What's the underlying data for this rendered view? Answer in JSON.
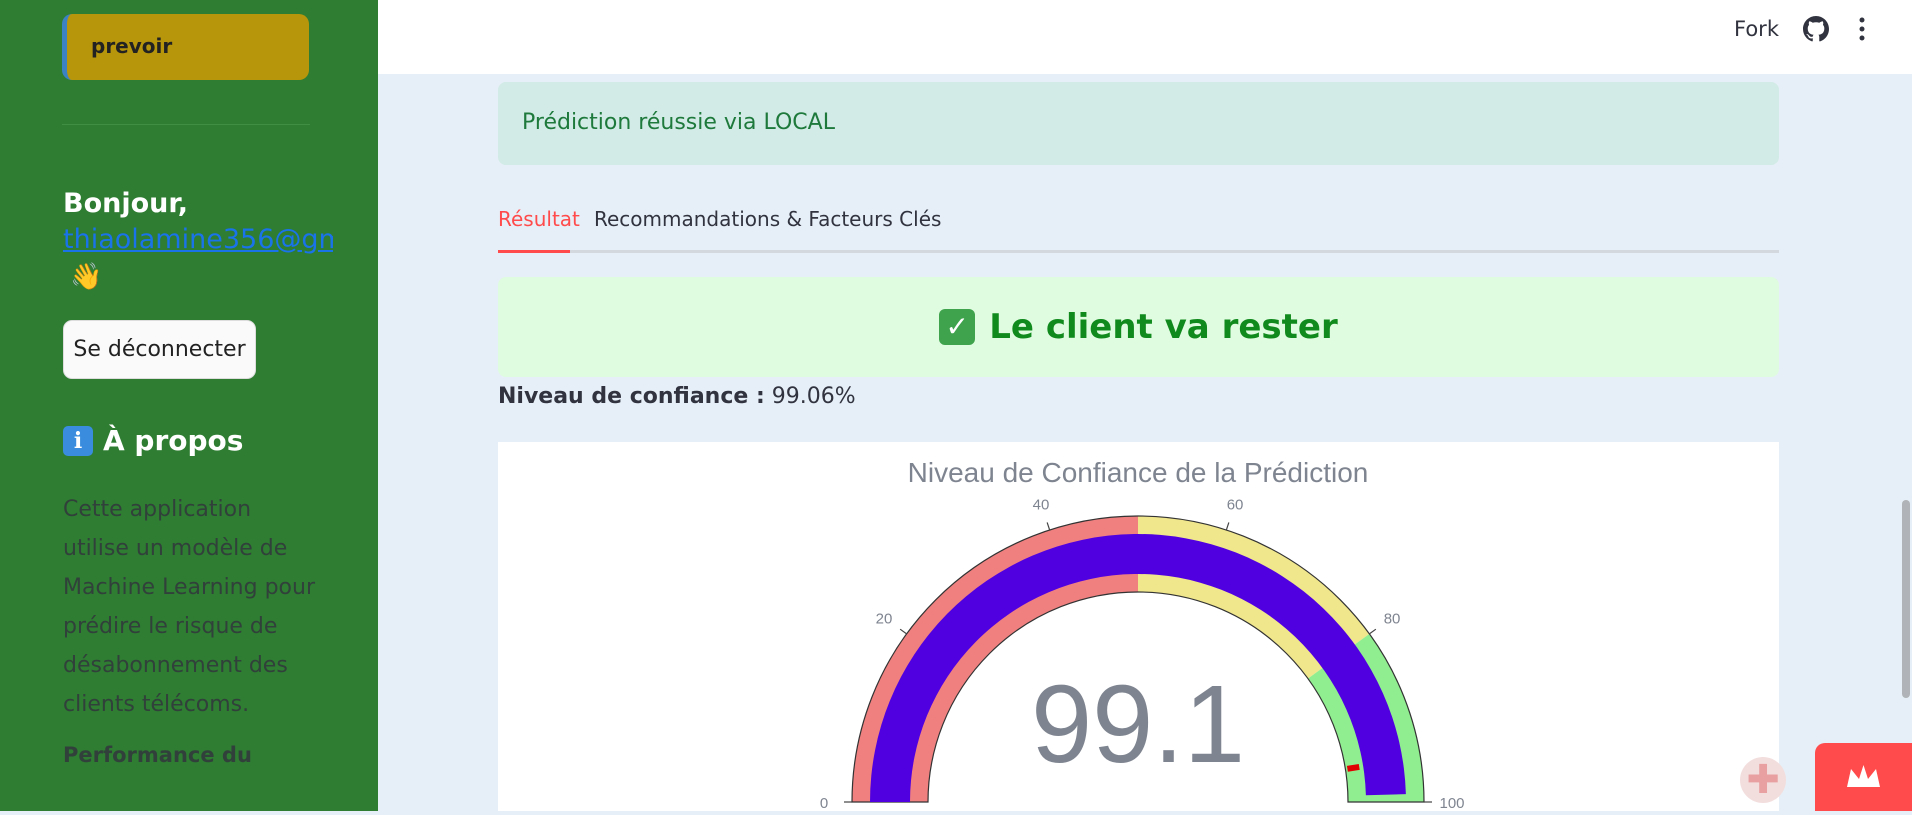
{
  "sidebar": {
    "predict_button_label": "prevoir",
    "greeting_title": "Bonjour,",
    "greeting_email": "thiaolamine356@gm",
    "wave_emoji": "👋",
    "logout_button_label": "Se déconnecter",
    "about_title": "À propos",
    "about_text": "Cette application utilise un modèle de Machine Learning pour prédire le risque de désabonnement des clients télécoms.",
    "performance_title": "Performance du"
  },
  "topbar": {
    "fork_label": "Fork"
  },
  "main": {
    "success_message": "Prédiction réussie via LOCAL",
    "tabs": [
      {
        "label": "Résultat",
        "active": true
      },
      {
        "label": "Recommandations & Facteurs Clés",
        "active": false
      }
    ],
    "result_text": "Le client va rester",
    "confidence_label": "Niveau de confiance :",
    "confidence_value": "99.06%"
  },
  "chart_data": {
    "type": "gauge",
    "title": "Niveau de Confiance de la Prédiction",
    "value": 99.06,
    "display_value": "99.1",
    "range": [
      0,
      100
    ],
    "tick_labels": [
      "0",
      "20",
      "40",
      "60",
      "80",
      "100"
    ],
    "bands": [
      {
        "from": 0,
        "to": 50,
        "color": "#f08080"
      },
      {
        "from": 50,
        "to": 80,
        "color": "#f0e68c"
      },
      {
        "from": 80,
        "to": 100,
        "color": "#90ee90"
      }
    ],
    "bar_color": "#5000e0",
    "threshold": 95,
    "threshold_color": "#e00000"
  },
  "colors": {
    "sidebar_bg": "#2e7d32",
    "accent": "#ff4b4b",
    "success_text": "#118a1d"
  }
}
